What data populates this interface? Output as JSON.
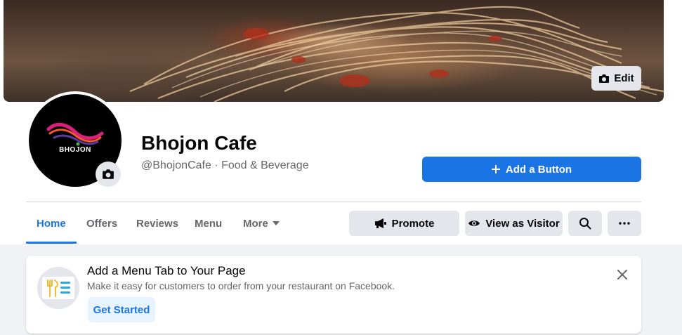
{
  "cover": {
    "edit_label": "Edit"
  },
  "profile": {
    "logo_text": "BHOJON",
    "name": "Bhojon Cafe",
    "subtitle": "@BhojonCafe · Food & Beverage"
  },
  "header_actions": {
    "add_button_label": "Add a Button"
  },
  "tabs": [
    {
      "label": "Home",
      "active": true
    },
    {
      "label": "Offers",
      "active": false
    },
    {
      "label": "Reviews",
      "active": false
    },
    {
      "label": "Menu",
      "active": false
    },
    {
      "label": "More",
      "active": false
    }
  ],
  "toolbar": {
    "promote_label": "Promote",
    "view_as_visitor_label": "View as Visitor",
    "search_icon": "search-icon",
    "more_icon": "ellipsis-icon"
  },
  "menu_card": {
    "title": "Add a Menu Tab to Your Page",
    "description": "Make it easy for customers to order from your restaurant on Facebook.",
    "cta_label": "Get Started"
  },
  "colors": {
    "accent": "#1b74e4",
    "button_gray": "#e4e6eb",
    "feed_background": "#f0f2f5",
    "secondary_text": "#65676b"
  }
}
